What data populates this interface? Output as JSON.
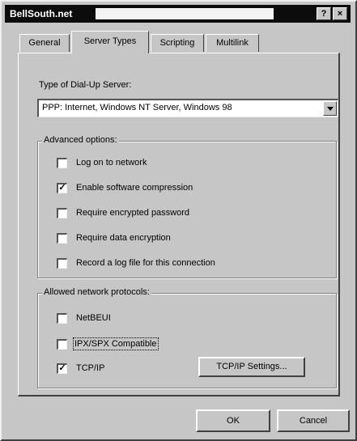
{
  "window": {
    "title": "BellSouth.net",
    "help_label": "?",
    "close_label": "×"
  },
  "tabs": [
    {
      "label": "General",
      "active": false
    },
    {
      "label": "Server Types",
      "active": true
    },
    {
      "label": "Scripting",
      "active": false
    },
    {
      "label": "Multilink",
      "active": false
    }
  ],
  "server_type": {
    "label": "Type of Dial-Up Server:",
    "value": "PPP: Internet, Windows NT Server, Windows 98"
  },
  "advanced_options": {
    "title": "Advanced options:",
    "items": [
      {
        "label": "Log on to network",
        "checked": false
      },
      {
        "label": "Enable software compression",
        "checked": true
      },
      {
        "label": "Require encrypted password",
        "checked": false
      },
      {
        "label": "Require data encryption",
        "checked": false
      },
      {
        "label": "Record a log file for this connection",
        "checked": false
      }
    ]
  },
  "protocols": {
    "title": "Allowed network protocols:",
    "items": [
      {
        "label": "NetBEUI",
        "checked": false
      },
      {
        "label": "IPX/SPX Compatible",
        "checked": false
      },
      {
        "label": "TCP/IP",
        "checked": true
      }
    ],
    "tcpip_settings_label": "TCP/IP Settings..."
  },
  "buttons": {
    "ok": "OK",
    "cancel": "Cancel"
  },
  "check_mark": "✓"
}
